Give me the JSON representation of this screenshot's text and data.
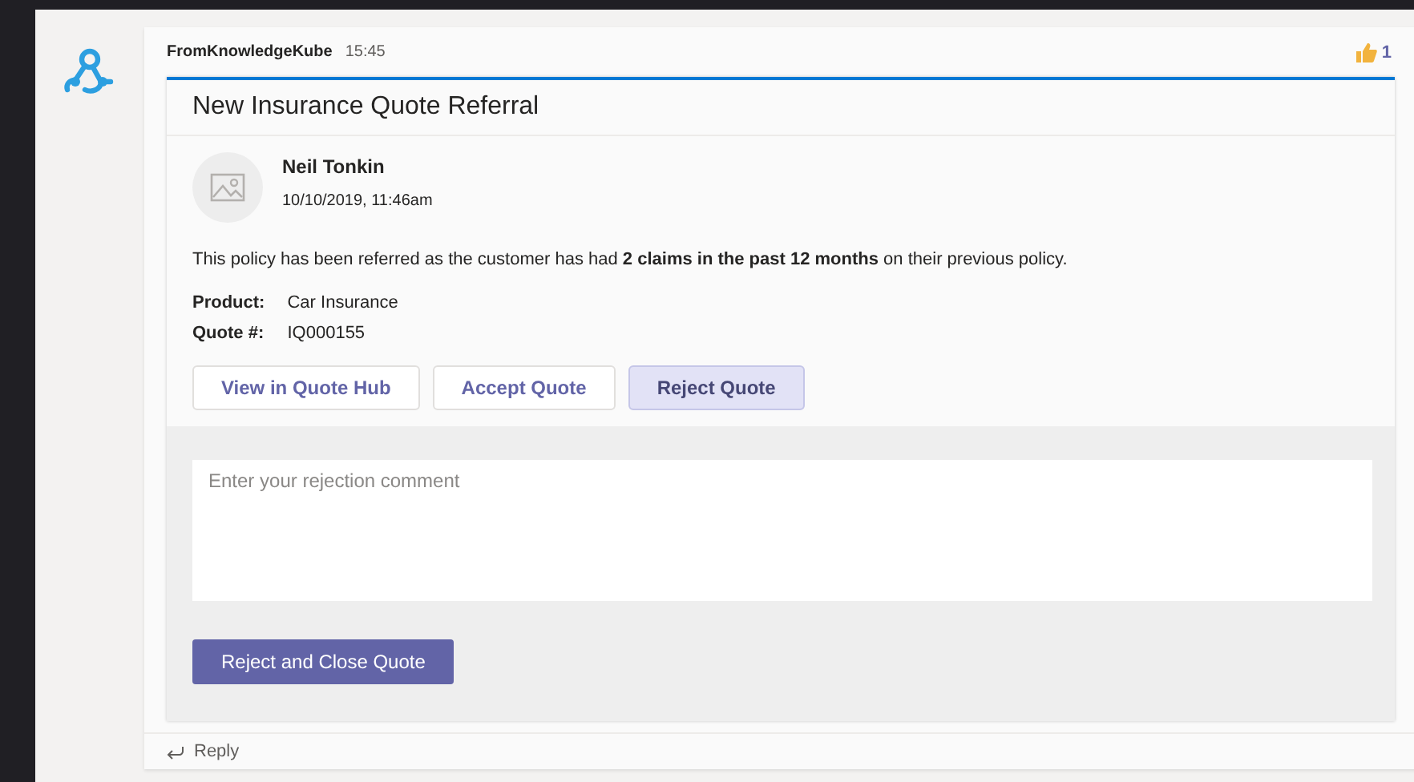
{
  "message": {
    "sender": "FromKnowledgeKube",
    "time": "15:45",
    "like_count": "1"
  },
  "card": {
    "title": "New Insurance Quote Referral",
    "author": {
      "name": "Neil Tonkin",
      "date": "10/10/2019, 11:46am"
    },
    "body": "This policy has been referred as the customer has had **2 claims in the past 12 months** on their previous policy.",
    "facts": [
      {
        "label": "Product:",
        "value": "Car Insurance"
      },
      {
        "label": "Quote #:",
        "value": "IQ000155"
      }
    ],
    "actions": [
      {
        "label": "View in Quote Hub",
        "selected": false
      },
      {
        "label": "Accept Quote",
        "selected": false
      },
      {
        "label": "Reject Quote",
        "selected": true
      }
    ],
    "comment": {
      "placeholder": "Enter your rejection comment"
    },
    "submit": "Reject and Close Quote"
  },
  "reply": "Reply"
}
